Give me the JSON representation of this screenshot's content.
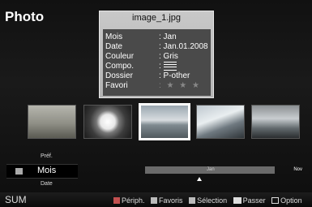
{
  "page": {
    "title": "Photo"
  },
  "info_panel": {
    "filename": "image_1.jpg",
    "rows": [
      {
        "key": "Mois",
        "value": ": Jan"
      },
      {
        "key": "Date",
        "value": ": Jan.01.2008"
      },
      {
        "key": "Couleur",
        "value": ": Gris"
      },
      {
        "key": "Compo.",
        "value": ":"
      },
      {
        "key": "Dossier",
        "value": ": P-other"
      },
      {
        "key": "Favori",
        "value": ": ★ ★ ★"
      }
    ],
    "compo_icon": "composition-lines-icon"
  },
  "thumbnails": [
    {
      "name": "thumbnail-sheep",
      "selected": false
    },
    {
      "name": "thumbnail-flower",
      "selected": false
    },
    {
      "name": "thumbnail-landscape",
      "selected": true
    },
    {
      "name": "thumbnail-mountains",
      "selected": false
    },
    {
      "name": "thumbnail-waterfall",
      "selected": false
    }
  ],
  "sort": {
    "prev": "Préf.",
    "current": "Mois",
    "next": "Date"
  },
  "timeline": {
    "current": "Jan",
    "end": "Nov"
  },
  "bottom_bar": {
    "sum": "SUM",
    "periph": "Périph.",
    "favoris": "Favoris",
    "selection": "Sélection",
    "passer": "Passer",
    "option": "Option"
  }
}
